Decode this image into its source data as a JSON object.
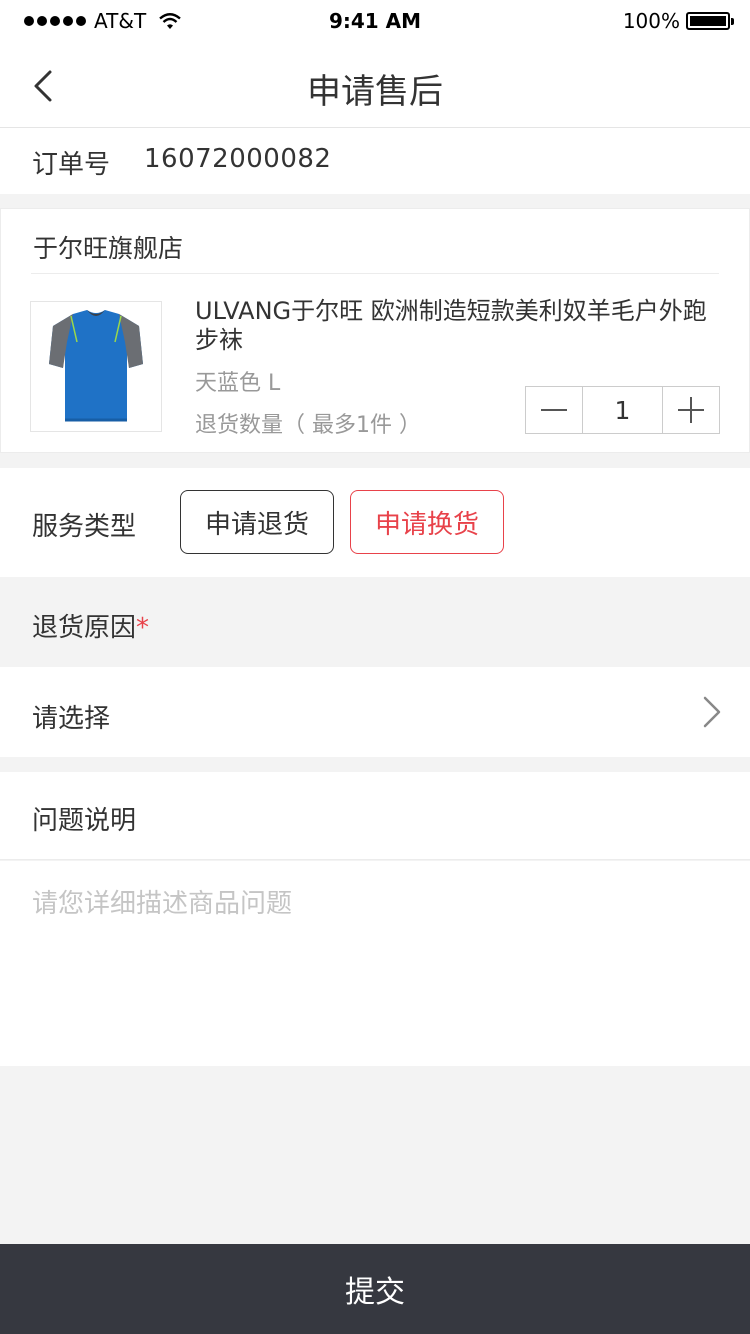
{
  "status_bar": {
    "carrier": "AT&T",
    "time": "9:41 AM",
    "battery": "100%"
  },
  "nav": {
    "title": "申请售后"
  },
  "order": {
    "label": "订单号",
    "number": "16072000082"
  },
  "product": {
    "shop_name": "于尔旺旗舰店",
    "name": "ULVANG于尔旺 欧洲制造短款美利奴羊毛户外跑步袜",
    "spec": "天蓝色   L",
    "qty_label": "退货数量（ 最多1件 ）",
    "quantity": "1",
    "image_colors": {
      "body": "#1f72c6",
      "sleeve": "#6b6e73",
      "accent": "#9bd84a"
    }
  },
  "service": {
    "label": "服务类型",
    "options": [
      {
        "label": "申请退货",
        "color": "#333333"
      },
      {
        "label": "申请换货",
        "color": "#e8424a"
      }
    ]
  },
  "reason": {
    "label": "退货原因",
    "required_mark": "*",
    "select_placeholder": "请选择"
  },
  "description": {
    "label": "问题说明",
    "placeholder": "请您详细描述商品问题"
  },
  "submit": {
    "label": "提交"
  },
  "colors": {
    "accent_red": "#e8424a",
    "submit_bg": "#363840",
    "page_bg": "#f3f3f3"
  }
}
